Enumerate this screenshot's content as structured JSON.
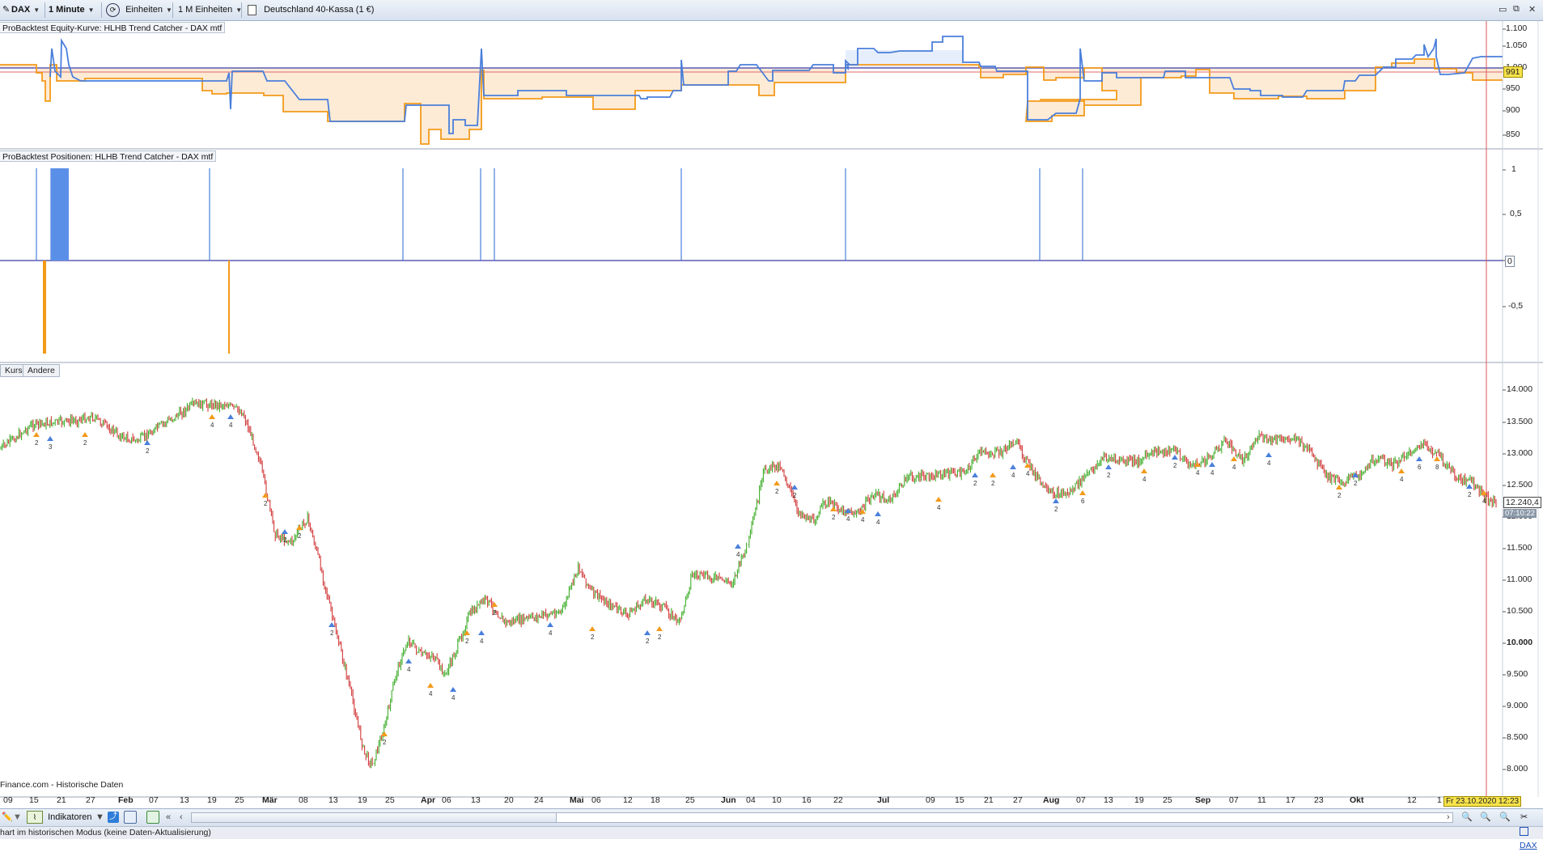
{
  "toolbar": {
    "instrument": "DAX",
    "timeframe": "1 Minute",
    "units_label": "Einheiten",
    "units_count": "1 M Einheiten",
    "instrument_name": "Deutschland 40-Kassa (1 €)"
  },
  "panels": {
    "equity_title": "ProBacktest Equity-Kurve: HLHB Trend Catcher - DAX mtf",
    "positions_title": "ProBacktest Positionen: HLHB Trend Catcher - DAX mtf",
    "price_tab_kurs": "Kurs",
    "price_tab_andere": "Andere",
    "source_note": "Finance.com - Historische Daten"
  },
  "equity_axis": {
    "ticks": [
      "1.100",
      "1.050",
      "1.000",
      "950",
      "900",
      "850"
    ],
    "marker": "991"
  },
  "positions_axis": {
    "ticks": [
      "1",
      "0,5",
      "0",
      "-0,5"
    ]
  },
  "price_axis": {
    "ticks": [
      "14.000",
      "13.500",
      "13.000",
      "12.500",
      "12.000",
      "11.500",
      "11.000",
      "10.500",
      "10.000",
      "9.500",
      "9.000",
      "8.500",
      "8.000"
    ],
    "current_price": "12.240,4",
    "current_time": "07:10:22"
  },
  "time_axis": {
    "labels": [
      "09",
      "15",
      "21",
      "27",
      "Feb",
      "07",
      "13",
      "19",
      "25",
      "Mär",
      "08",
      "13",
      "19",
      "25",
      "Apr",
      "06",
      "13",
      "20",
      "24",
      "Mai",
      "06",
      "12",
      "18",
      "25",
      "Jun",
      "04",
      "10",
      "16",
      "22",
      "Jul",
      "09",
      "15",
      "21",
      "27",
      "Aug",
      "07",
      "13",
      "19",
      "25",
      "Sep",
      "07",
      "11",
      "17",
      "23",
      "Okt",
      "12",
      "1"
    ],
    "cursor_label": "Fr 23.10.2020 12:23"
  },
  "bottombar": {
    "indicators_label": "Indikatoren",
    "dax_link": "DAX"
  },
  "status": {
    "text": "hart im historischen Modus (keine Daten-Aktualisierung)"
  },
  "colors": {
    "equity_blue": "#4a7fdb",
    "equity_orange": "#f39a1a",
    "candle_up": "#3fae2a",
    "candle_down": "#d23b3b",
    "marker_yellow": "#f7e34a"
  }
}
